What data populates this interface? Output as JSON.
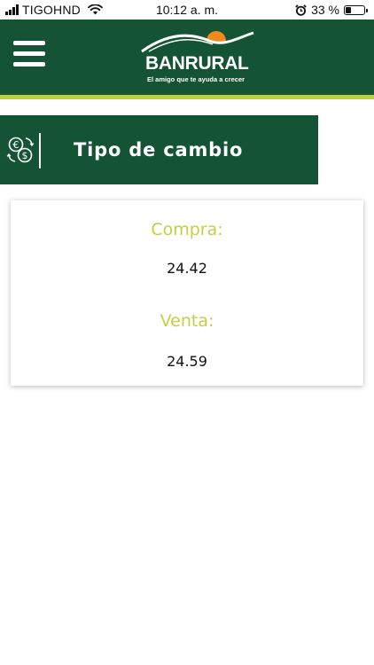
{
  "status_bar": {
    "carrier": "TIGOHND",
    "time": "10:12 a. m.",
    "battery_percent_text": "33 %",
    "battery_level": 0.33,
    "icons": [
      "signal-icon",
      "wifi-icon",
      "alarm-icon",
      "battery-icon"
    ]
  },
  "header": {
    "menu_icon": "hamburger-menu-icon",
    "logo_name": "BANRURAL",
    "logo_tagline": "El amigo que te ayuda a crecer"
  },
  "section": {
    "icon": "currency-exchange-icon",
    "title": "Tipo de cambio"
  },
  "rates": {
    "buy_label": "Compra:",
    "buy_value": "24.42",
    "sell_label": "Venta:",
    "sell_value": "24.59"
  },
  "colors": {
    "brand_green": "#155335",
    "accent_lime": "#b9cf3a",
    "label_lime": "#c5cf42",
    "logo_orange": "#f08a1c"
  }
}
